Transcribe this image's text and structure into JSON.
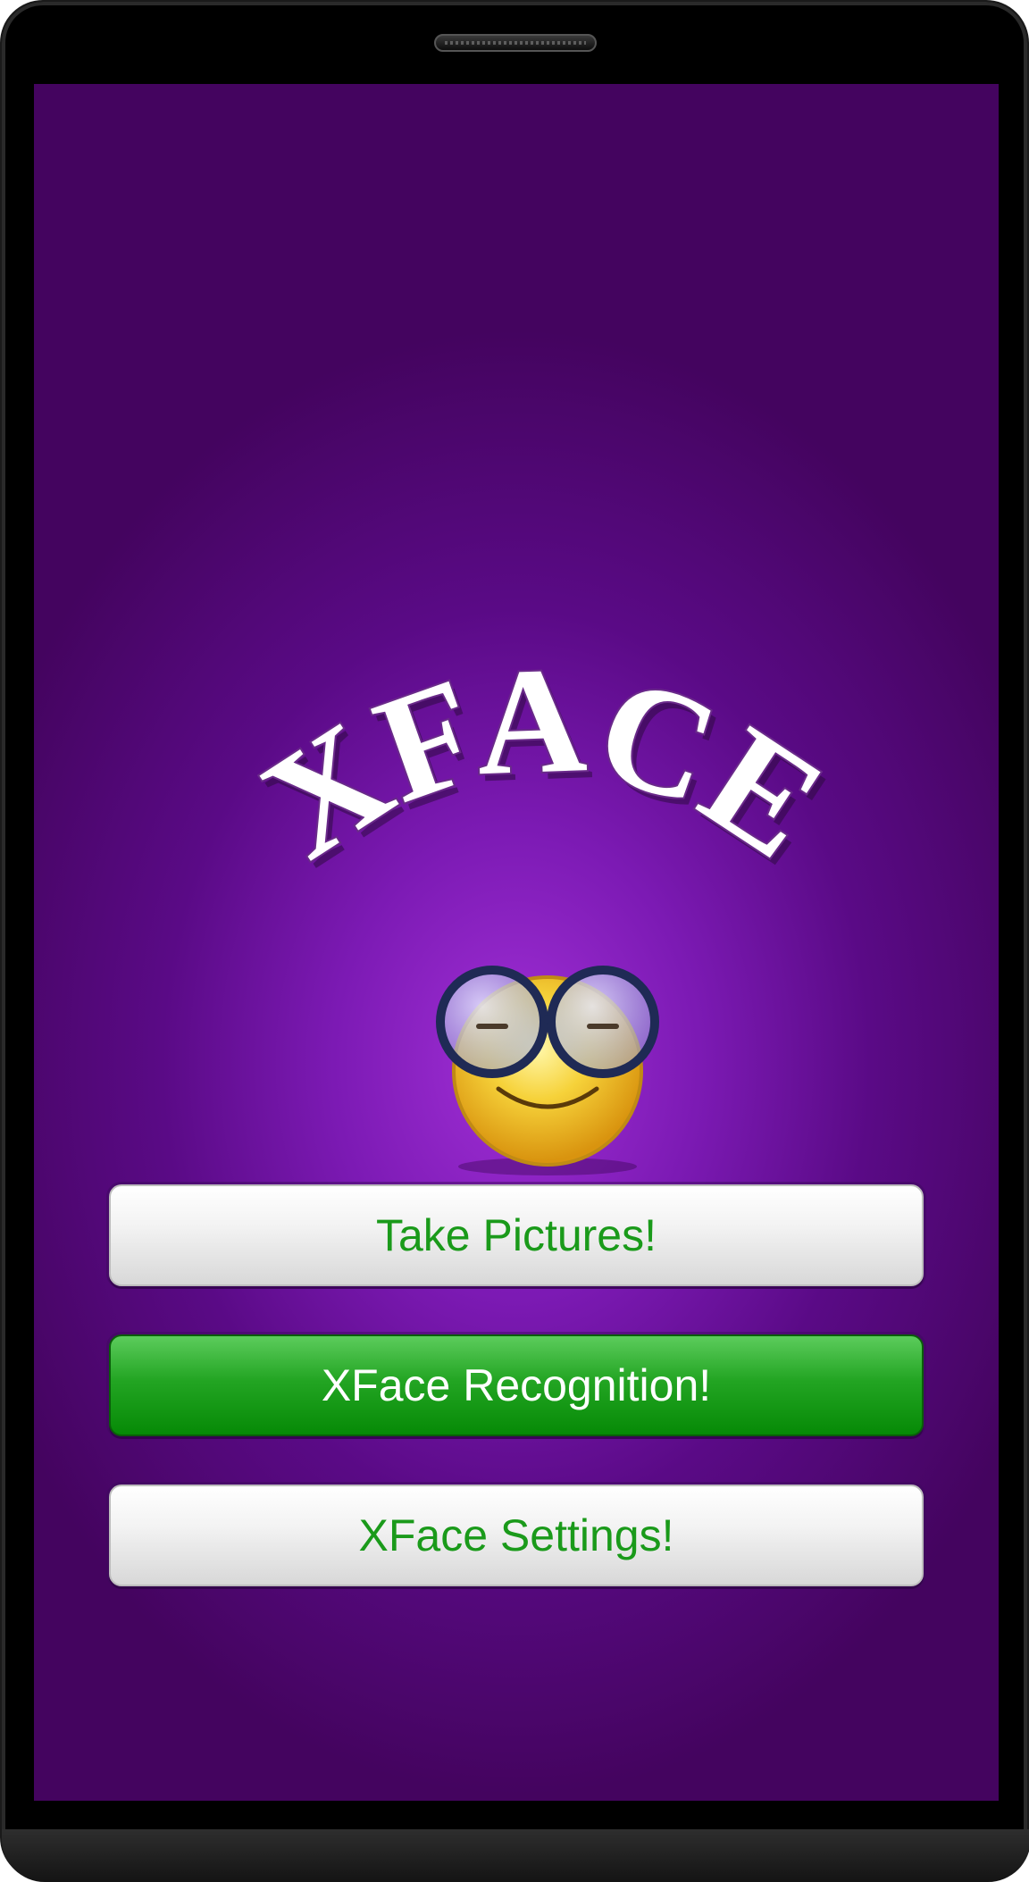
{
  "app": {
    "logo_text": "XFACE",
    "logo_icon": "xface-logo",
    "mascot_icon": "smiley-glasses-icon"
  },
  "buttons": {
    "take_pictures": "Take Pictures!",
    "recognition": "XFace Recognition!",
    "settings": "XFace Settings!"
  },
  "colors": {
    "background": "#7c1ab4",
    "primary_button": "#0b8f0b",
    "button_text_green": "#1a9a1a",
    "button_text_white": "#ffffff"
  }
}
